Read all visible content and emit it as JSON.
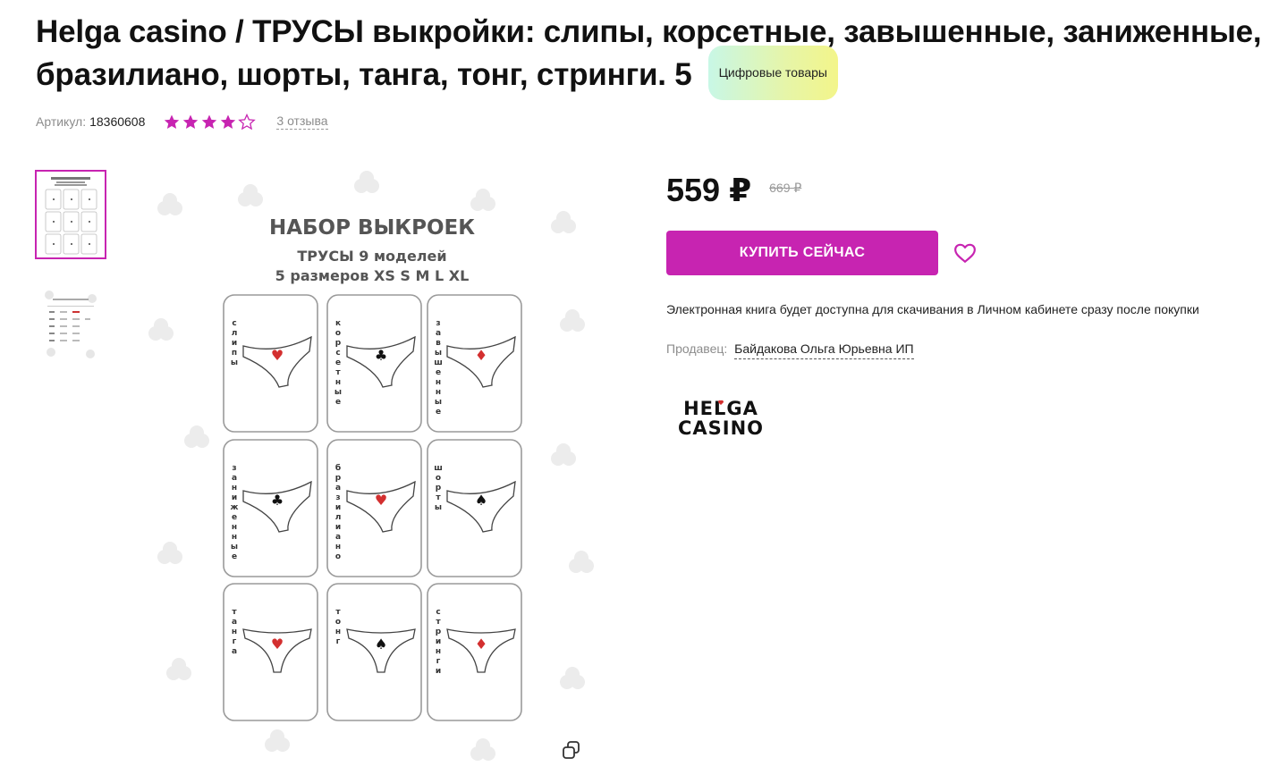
{
  "product": {
    "title": "Helga casino / ТРУСЫ выкройки: слипы, корсетные, завышенные, заниженные, бразилиано, шорты, танга, тонг, стринги. 5",
    "badge": "Цифровые товары",
    "sku_label": "Артикул:",
    "sku_value": "18360608",
    "rating": 4,
    "rating_max": 5,
    "reviews_text": "3 отзыва"
  },
  "pricing": {
    "price": "559 ₽",
    "old_price": "669 ₽"
  },
  "actions": {
    "buy_label": "КУПИТЬ СЕЙЧАС"
  },
  "info": {
    "note": "Электронная книга будет доступна для скачивания в Личном кабинете сразу после покупки",
    "seller_label": "Продавец:",
    "seller_name": "Байдакова Ольга Юрьевна ИП"
  },
  "brand": {
    "line1": "HELGA",
    "line2": "CASINO"
  },
  "image": {
    "heading": "НАБОР ВЫКРОЕК",
    "sub1": "ТРУСЫ 9 моделей",
    "sub2": "5 размеров XS S M L XL",
    "cards": [
      {
        "label": "слипы",
        "suit": "♥",
        "suit_color": "#d32f2f"
      },
      {
        "label": "корсетные",
        "suit": "♣",
        "suit_color": "#111111"
      },
      {
        "label": "завышенные",
        "suit": "♦",
        "suit_color": "#d32f2f"
      },
      {
        "label": "заниженные",
        "suit": "♣",
        "suit_color": "#111111"
      },
      {
        "label": "бразилиано",
        "suit": "♥",
        "suit_color": "#d32f2f"
      },
      {
        "label": "шорты",
        "suit": "♠",
        "suit_color": "#111111"
      },
      {
        "label": "танга",
        "suit": "♥",
        "suit_color": "#d32f2f"
      },
      {
        "label": "тонг",
        "suit": "♠",
        "suit_color": "#111111"
      },
      {
        "label": "стринги",
        "suit": "♦",
        "suit_color": "#d32f2f"
      }
    ]
  },
  "colors": {
    "accent": "#c724b1",
    "star": "#c724b1"
  },
  "icons": {
    "star": "star-icon",
    "favorite": "heart-outline-icon",
    "copy": "copy-icon"
  }
}
